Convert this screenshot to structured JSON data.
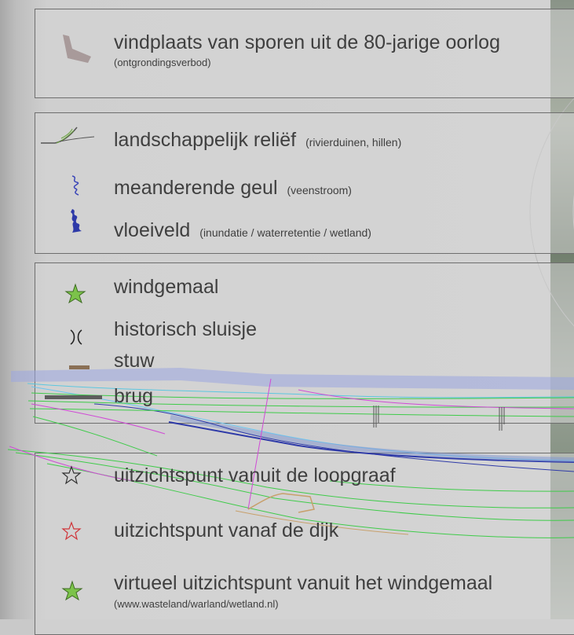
{
  "legend": {
    "group1": {
      "item1": {
        "label": "vindplaats van sporen uit de 80-jarige oorlog",
        "note": "(ontgrondingsverbod)",
        "icon": "excavation-spade-icon"
      }
    },
    "group2": {
      "item1": {
        "label": "landschappelijk reliëf",
        "note": "(rivierduinen, hillen)",
        "icon": "relief-contour-icon"
      },
      "item2": {
        "label": "meanderende geul",
        "note": "(veenstroom)",
        "icon": "meander-channel-icon"
      },
      "item3": {
        "label": "vloeiveld",
        "note": "(inundatie / waterretentie / wetland)",
        "icon": "flood-field-icon"
      }
    },
    "group3": {
      "item1": {
        "label": "windgemaal",
        "icon": "green-star-icon"
      },
      "item2": {
        "label": "historisch sluisje",
        "icon": "sluice-icon"
      },
      "item3": {
        "label": "stuw",
        "icon": "weir-bar-icon"
      },
      "item4": {
        "label": "brug",
        "icon": "bridge-bar-icon"
      }
    },
    "group4": {
      "item1": {
        "label": "uitzichtspunt vanuit de loopgraaf",
        "icon": "outline-star-dark-icon"
      },
      "item2": {
        "label": "uitzichtspunt vanaf de dijk",
        "icon": "outline-star-red-icon"
      },
      "item3": {
        "label": "virtueel uitzichtspunt vanuit het windgemaal",
        "note": "(www.wasteland/warland/wetland.nl)",
        "icon": "green-star-icon"
      }
    }
  },
  "colors": {
    "text": "#3f3f3f",
    "border": "#6e6e6e",
    "water": "#8f9fe0",
    "channel": "#2e3aa8",
    "contour": "#3ecb49",
    "parcel": "#d04bd6",
    "star_green": "#7cc34a",
    "bar_brown": "#8a7055"
  }
}
